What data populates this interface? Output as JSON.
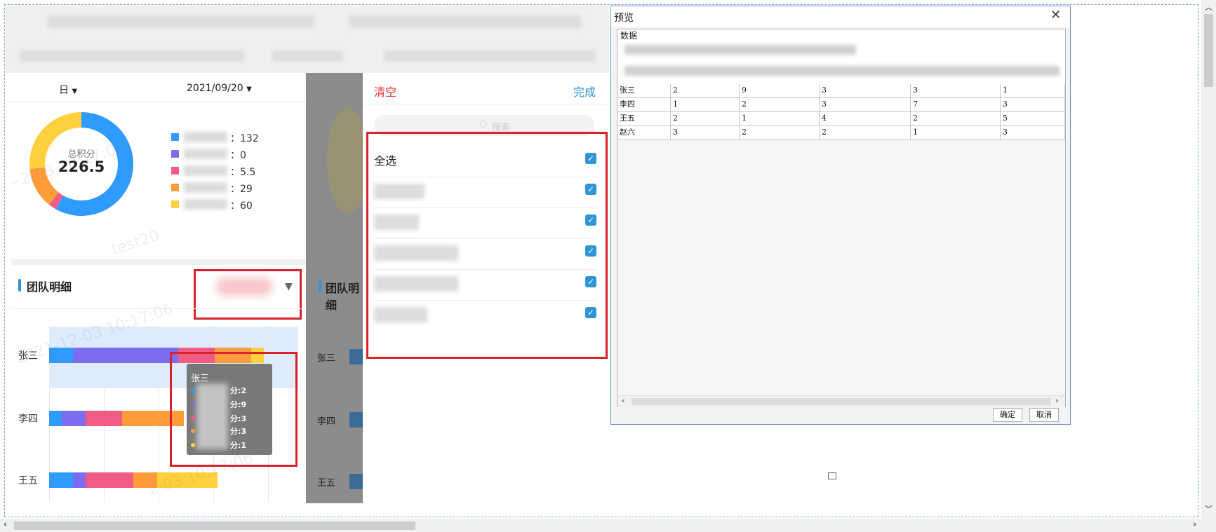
{
  "left": {
    "period": "日",
    "date": "2021/09/20",
    "donut_label": "总积分",
    "donut_total": "226.5",
    "legend": [
      {
        "color": "#2f9bff",
        "value": "132"
      },
      {
        "color": "#7b6cf0",
        "value": "0"
      },
      {
        "color": "#f25c84",
        "value": "5.5"
      },
      {
        "color": "#ff9c3a",
        "value": "29"
      },
      {
        "color": "#ffd03d",
        "value": "60"
      }
    ],
    "section_title": "团队明细",
    "bar_rows": [
      "张三",
      "李四",
      "王五"
    ],
    "tooltip": {
      "name": "张三",
      "lines": [
        "分:2",
        "分:9",
        "分:3",
        "分:3",
        "分:1"
      ]
    }
  },
  "right_chart": {
    "section_title": "团队明细",
    "bar_rows": [
      "张三",
      "李四",
      "王五"
    ]
  },
  "filter": {
    "clear": "清空",
    "done": "完成",
    "search_placeholder": "搜索",
    "select_all": "全选"
  },
  "dialog": {
    "title": "预览",
    "tab": "数据",
    "rows": [
      [
        "张三",
        "2",
        "9",
        "3",
        "3",
        "1"
      ],
      [
        "李四",
        "1",
        "2",
        "3",
        "7",
        "3"
      ],
      [
        "王五",
        "2",
        "1",
        "4",
        "2",
        "5"
      ],
      [
        "赵六",
        "3",
        "2",
        "2",
        "1",
        "3"
      ]
    ],
    "confirm": "确定",
    "cancel": "取消"
  },
  "colors": {
    "blue": "#2f9bff",
    "purple": "#7b6cf0",
    "pink": "#f25c84",
    "orange": "#ff9c3a",
    "yellow": "#ffd03d",
    "accent": "#2f95d6",
    "danger": "#e4393c"
  }
}
